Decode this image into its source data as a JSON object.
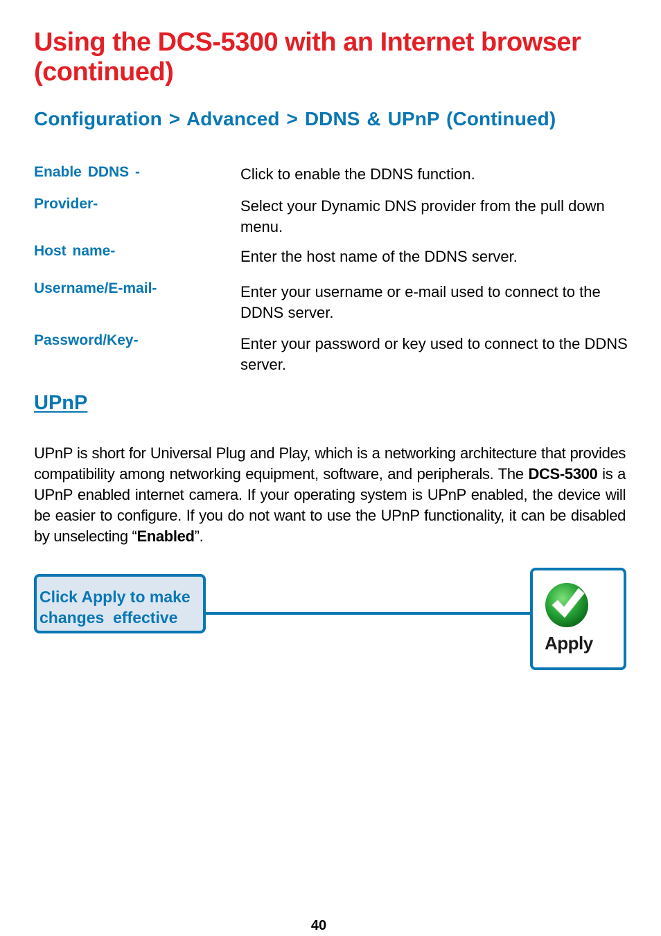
{
  "page": {
    "title": "Using the DCS-5300 with an Internet browser (continued)",
    "breadcrumb": "Configuration > Advanced > DDNS & UPnP (Continued)",
    "definitions": [
      {
        "term": "Enable DDNS -",
        "description": "Click to enable the DDNS function."
      },
      {
        "term": "Provider-",
        "description": "Select your Dynamic DNS provider from the pull down menu."
      },
      {
        "term": "Host name-",
        "description": "Enter the host name of the DDNS server."
      },
      {
        "term": "Username/E-mail-",
        "description": "Enter your username or e-mail used to connect to the DDNS server."
      },
      {
        "term": "Password/Key-",
        "description": "Enter your password or key used to connect to the DDNS server."
      }
    ],
    "upnp": {
      "heading": "UPnP",
      "para_part1": "UPnP is short for Universal Plug and Play, which is a networking architecture that provides compatibility among networking equipment, software, and peripherals. The ",
      "para_bold1": "DCS-5300",
      "para_part2": " is a UPnP enabled internet camera. If your operating system is UPnP enabled, the device will be easier to configure. If you do not want to use the UPnP functionality, it can be disabled by unselecting “",
      "para_bold2": "Enabled",
      "para_part3": "”."
    },
    "callout": {
      "line1": "Click Apply to make",
      "line2": "changes  effective"
    },
    "apply_button": {
      "icon": "green-checkmark-icon",
      "label": "Apply"
    },
    "page_number": "40"
  },
  "colors": {
    "title_red": "#e31f26",
    "accent_blue": "#0a77b4",
    "callout_bg": "#dce6f1",
    "check_green": "#2aa83a"
  }
}
